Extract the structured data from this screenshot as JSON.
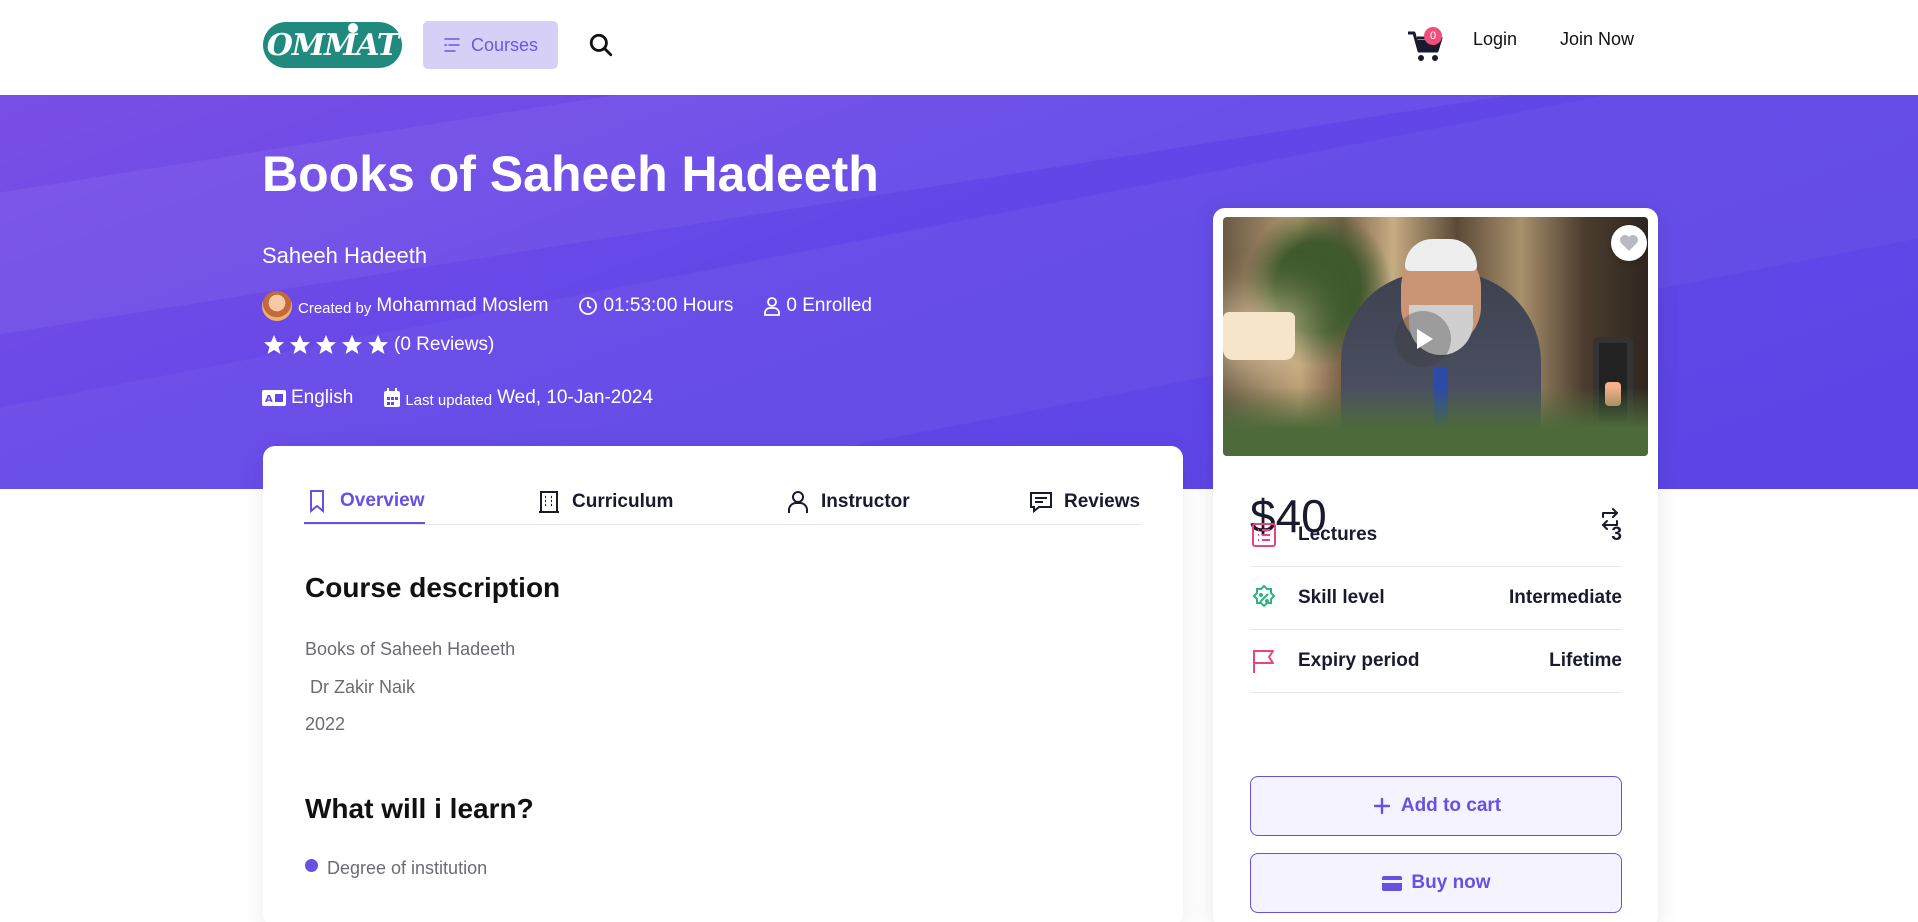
{
  "header": {
    "logo_text": "OMMAT",
    "courses_label": "Courses",
    "cart_count": "0",
    "login_label": "Login",
    "join_label": "Join Now"
  },
  "hero": {
    "title": "Books of Saheeh Hadeeth",
    "subtitle": "Saheeh Hadeeth",
    "created_by_prefix": "Created by",
    "author": "Mohammad Moslem",
    "duration": "01:53:00 Hours",
    "enrolled": "0 Enrolled",
    "rating_stars": 5,
    "reviews": "(0 Reviews)",
    "language": "English",
    "last_updated_prefix": "Last updated",
    "last_updated": "Wed, 10-Jan-2024"
  },
  "tabs": [
    {
      "label": "Overview",
      "icon": "bookmark-icon",
      "active": true
    },
    {
      "label": "Curriculum",
      "icon": "building-icon",
      "active": false
    },
    {
      "label": "Instructor",
      "icon": "user-icon",
      "active": false
    },
    {
      "label": "Reviews",
      "icon": "chat-icon",
      "active": false
    }
  ],
  "overview": {
    "description_title": "Course description",
    "description_lines": [
      "Books of Saheeh Hadeeth",
      " Dr Zakir Naik",
      "2022"
    ],
    "learn_title": "What will i learn?",
    "learn_items": [
      "Degree of institution"
    ]
  },
  "sidebar": {
    "price": "$40",
    "rows": [
      {
        "label": "Lectures",
        "value": "3",
        "icon": "list-icon",
        "color": "#e8467a"
      },
      {
        "label": "Skill level",
        "value": "Intermediate",
        "icon": "badge-percent-icon",
        "color": "#2fb381"
      },
      {
        "label": "Expiry period",
        "value": "Lifetime",
        "icon": "flag-icon",
        "color": "#e8467a"
      }
    ],
    "add_to_cart": "Add to cart",
    "buy_now": "Buy now"
  },
  "colors": {
    "accent": "#6a4fe3",
    "hero_gradient_start": "#7a4fe6",
    "hero_gradient_end": "#5b45e6",
    "badge": "#ef4f7a"
  }
}
